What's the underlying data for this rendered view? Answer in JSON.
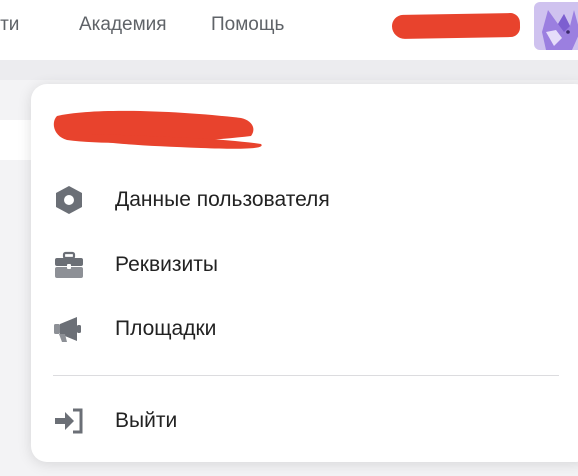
{
  "header": {
    "nav": [
      {
        "label": "ости"
      },
      {
        "label": "Академия"
      },
      {
        "label": "Помощь"
      }
    ],
    "avatar_icon": "fox-avatar-icon"
  },
  "menu": {
    "items": [
      {
        "label": "Данные пользователя",
        "icon": "hexagon-settings-icon"
      },
      {
        "label": "Реквизиты",
        "icon": "briefcase-icon"
      },
      {
        "label": "Площадки",
        "icon": "megaphone-icon"
      }
    ],
    "logout": {
      "label": "Выйти",
      "icon": "logout-icon"
    }
  },
  "colors": {
    "icon_gray": "#6b6f76",
    "text": "#222222",
    "redaction": "#e8432d",
    "avatar_bg": "#cfc2ef"
  }
}
